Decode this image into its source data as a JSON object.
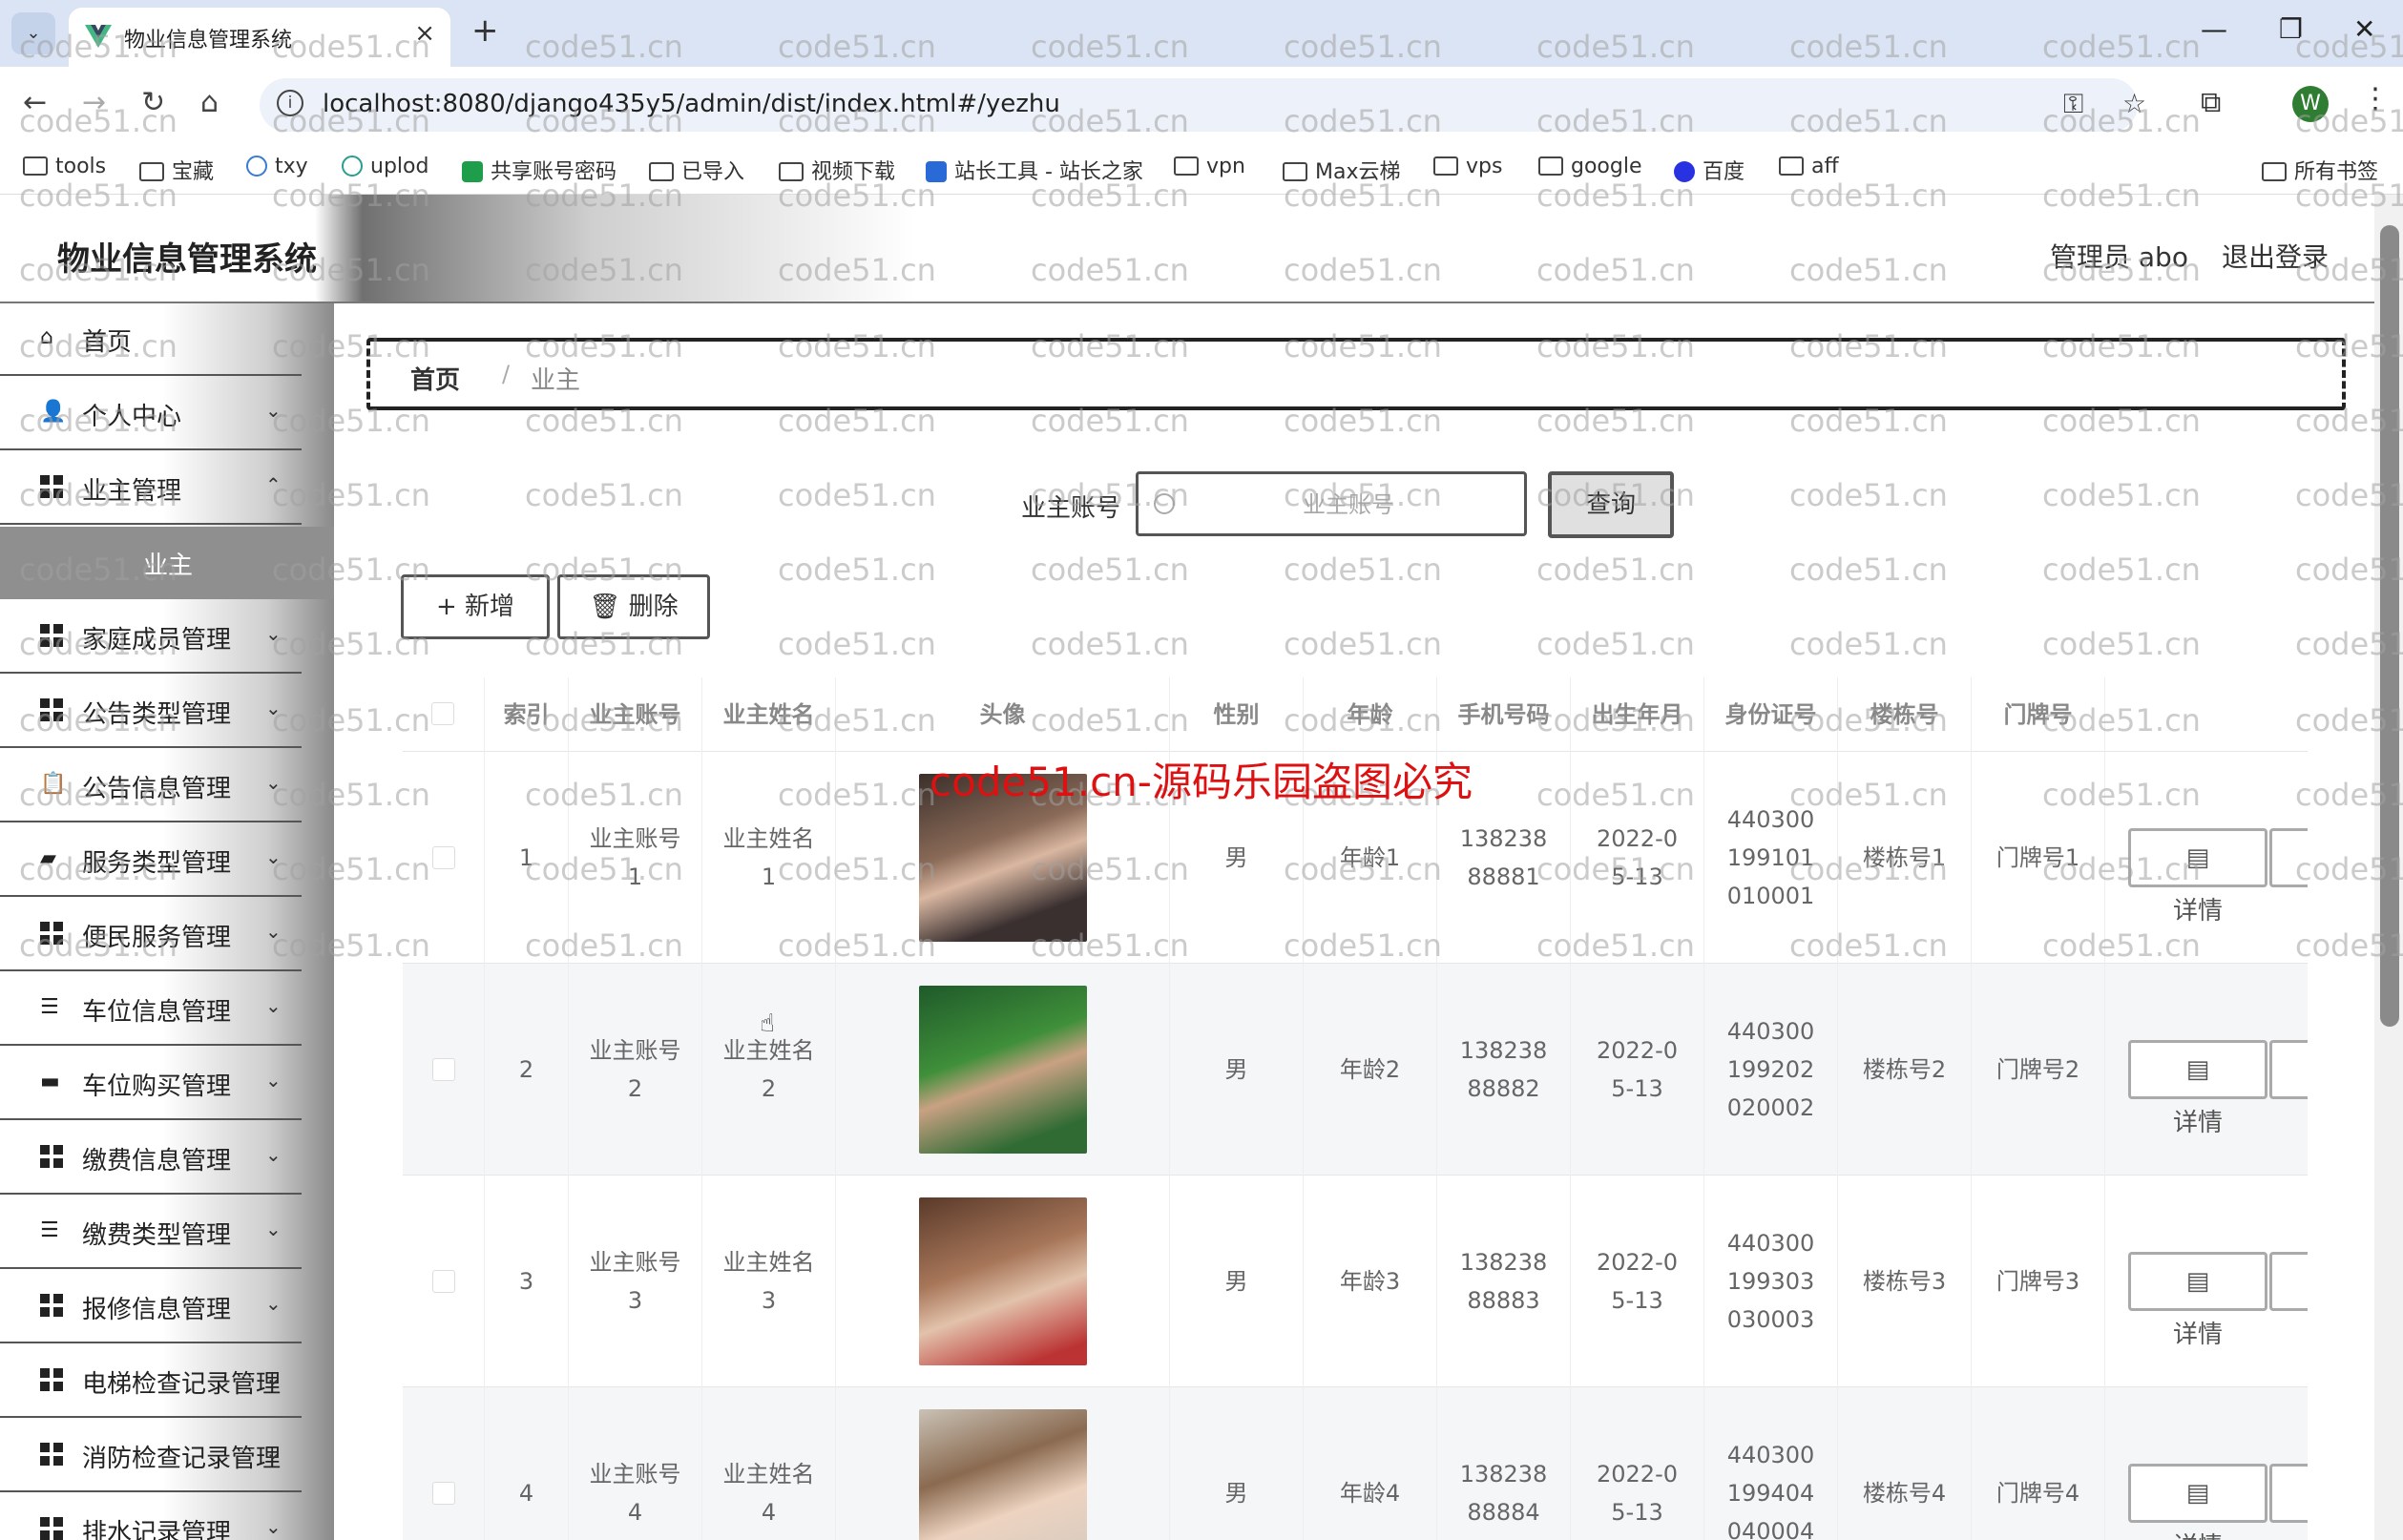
{
  "browser": {
    "tab_title": "物业信息管理系统",
    "url": "localhost:8080/django435y5/admin/dist/index.html#/yezhu",
    "profile_initial": "W",
    "bookmarks": [
      "tools",
      "宝藏",
      "txy",
      "uplod",
      "共享账号密码",
      "已导入",
      "视频下载",
      "站长工具 - 站长之家",
      "vpn",
      "Max云梯",
      "vps",
      "google",
      "百度",
      "aff"
    ],
    "all_bookmarks": "所有书签"
  },
  "header": {
    "title": "物业信息管理系统",
    "admin": "管理员 abo",
    "logout": "退出登录"
  },
  "sidebar": {
    "items": [
      {
        "label": "首页",
        "icon": "home-icon"
      },
      {
        "label": "个人中心",
        "icon": "user-icon"
      },
      {
        "label": "业主管理",
        "icon": "grid-icon"
      },
      {
        "label": "业主",
        "icon": "none"
      },
      {
        "label": "家庭成员管理",
        "icon": "grid-icon"
      },
      {
        "label": "公告类型管理",
        "icon": "grid-icon"
      },
      {
        "label": "公告信息管理",
        "icon": "clipboard-icon"
      },
      {
        "label": "服务类型管理",
        "icon": "wallet-icon"
      },
      {
        "label": "便民服务管理",
        "icon": "grid-icon"
      },
      {
        "label": "车位信息管理",
        "icon": "list-icon"
      },
      {
        "label": "车位购买管理",
        "icon": "chat-icon"
      },
      {
        "label": "缴费信息管理",
        "icon": "grid-icon"
      },
      {
        "label": "缴费类型管理",
        "icon": "list-icon"
      },
      {
        "label": "报修信息管理",
        "icon": "grid-icon"
      },
      {
        "label": "电梯检查记录管理",
        "icon": "grid-icon"
      },
      {
        "label": "消防检查记录管理",
        "icon": "grid-icon"
      },
      {
        "label": "排水记录管理",
        "icon": "grid-icon"
      }
    ]
  },
  "breadcrumb": {
    "home": "首页",
    "sep": "/",
    "current": "业主"
  },
  "search": {
    "label": "业主账号",
    "placeholder": "业主账号",
    "button": "查询"
  },
  "actions": {
    "add": "+ 新增",
    "delete": "删除"
  },
  "table": {
    "columns": [
      "索引",
      "业主账号",
      "业主姓名",
      "头像",
      "性别",
      "年龄",
      "手机号码",
      "出生年月",
      "身份证号",
      "楼栋号",
      "门牌号"
    ],
    "detail_label": "详情",
    "rows": [
      {
        "index": "1",
        "account": "业主账号1",
        "name": "业主姓名1",
        "gender": "男",
        "age": "年龄1",
        "phone": "13823888881",
        "birth": "2022-05-13",
        "id_card": "440300199101010001",
        "building": "楼栋号1",
        "door": "门牌号1"
      },
      {
        "index": "2",
        "account": "业主账号2",
        "name": "业主姓名2",
        "gender": "男",
        "age": "年龄2",
        "phone": "13823888882",
        "birth": "2022-05-13",
        "id_card": "440300199202020002",
        "building": "楼栋号2",
        "door": "门牌号2"
      },
      {
        "index": "3",
        "account": "业主账号3",
        "name": "业主姓名3",
        "gender": "男",
        "age": "年龄3",
        "phone": "13823888883",
        "birth": "2022-05-13",
        "id_card": "440300199303030003",
        "building": "楼栋号3",
        "door": "门牌号3"
      },
      {
        "index": "4",
        "account": "业主账号4",
        "name": "业主姓名4",
        "gender": "男",
        "age": "年龄4",
        "phone": "13823888884",
        "birth": "2022-05-13",
        "id_card": "440300199404040004",
        "building": "楼栋号4",
        "door": "门牌号4"
      }
    ]
  },
  "watermark": "code51.cn",
  "red_watermark": "code51.cn-源码乐园盗图必究"
}
